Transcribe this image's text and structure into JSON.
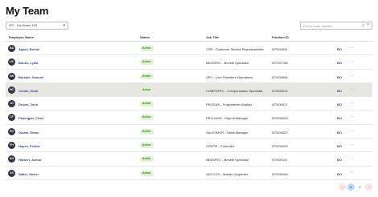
{
  "page": {
    "title": "My Team"
  },
  "filter": {
    "selected": "IST - Go Green 100"
  },
  "search": {
    "placeholder": "Find a team member"
  },
  "table": {
    "headers": [
      "Employee Name",
      "Status",
      "Job Title",
      "Position ID"
    ],
    "rows": [
      {
        "initials": "BA",
        "name": "Agard, Bernie",
        "status": "Active",
        "job": "CSR - Customer Service Representative",
        "position": "IST600091",
        "action": "BO",
        "highlight": false
      },
      {
        "initials": "LB",
        "name": "Banks, Lydia",
        "status": "Active",
        "job": "BENSPEC - Benefit Specialist",
        "position": "IST997766",
        "action": "BO",
        "highlight": false
      },
      {
        "initials": "SB",
        "name": "Barkate, Samuel",
        "status": "Active",
        "job": "VPO - Vice President Operations",
        "position": "IST600006",
        "action": "BO",
        "highlight": false
      },
      {
        "initials": "HC",
        "name": "Conde, Heidi",
        "status": "Active",
        "job": "COMPSPEC - Compensation Specialist",
        "position": "IST600012",
        "action": "BO",
        "highlight": true
      },
      {
        "initials": "JD",
        "name": "Dexter, John",
        "status": "Active",
        "job": "PROGAN - Programmer Analyst",
        "position": "IST600017",
        "action": "BO",
        "highlight": false
      },
      {
        "initials": "CF",
        "name": "Flannigan, Chris",
        "status": "Active",
        "job": "PRYLMGR - Payroll Manager",
        "position": "IST600020",
        "action": "BO",
        "highlight": false
      },
      {
        "initials": "EG",
        "name": "Galani, Ethan",
        "status": "Active",
        "job": "SALESMGR - Sales Manager",
        "position": "IST600022",
        "action": "BO",
        "highlight": false
      },
      {
        "initials": "FH",
        "name": "Hayes, Felicia",
        "status": "Active",
        "job": "CONTR - Controller",
        "position": "IST600029",
        "action": "BO",
        "highlight": false
      },
      {
        "initials": "AH",
        "name": "Hibbert, Anmar",
        "status": "Active",
        "job": "BENSPEC - Benefit Specialist",
        "position": "IST600101",
        "action": "BO",
        "highlight": false
      },
      {
        "initials": "XS",
        "name": "Saber, Xavier",
        "status": "Active",
        "job": "15O CCG - Master Carpenter",
        "position": "IST600040",
        "action": "BO",
        "highlight": false
      }
    ]
  },
  "pagination": {
    "prev": "‹",
    "pages": [
      "1",
      "2"
    ],
    "current": "1",
    "next": "›"
  },
  "icons": {
    "search": "search-icon",
    "clear": "close-icon",
    "dropdown": "chevron-down-icon",
    "more": "more-horizontal-icon"
  },
  "colors": {
    "link": "#3a4a8a",
    "active_badge_bg": "#dff3d3",
    "active_badge_text": "#3f7d23",
    "highlight_row": "#e8e6e1",
    "current_page": "#b7d9f4"
  }
}
